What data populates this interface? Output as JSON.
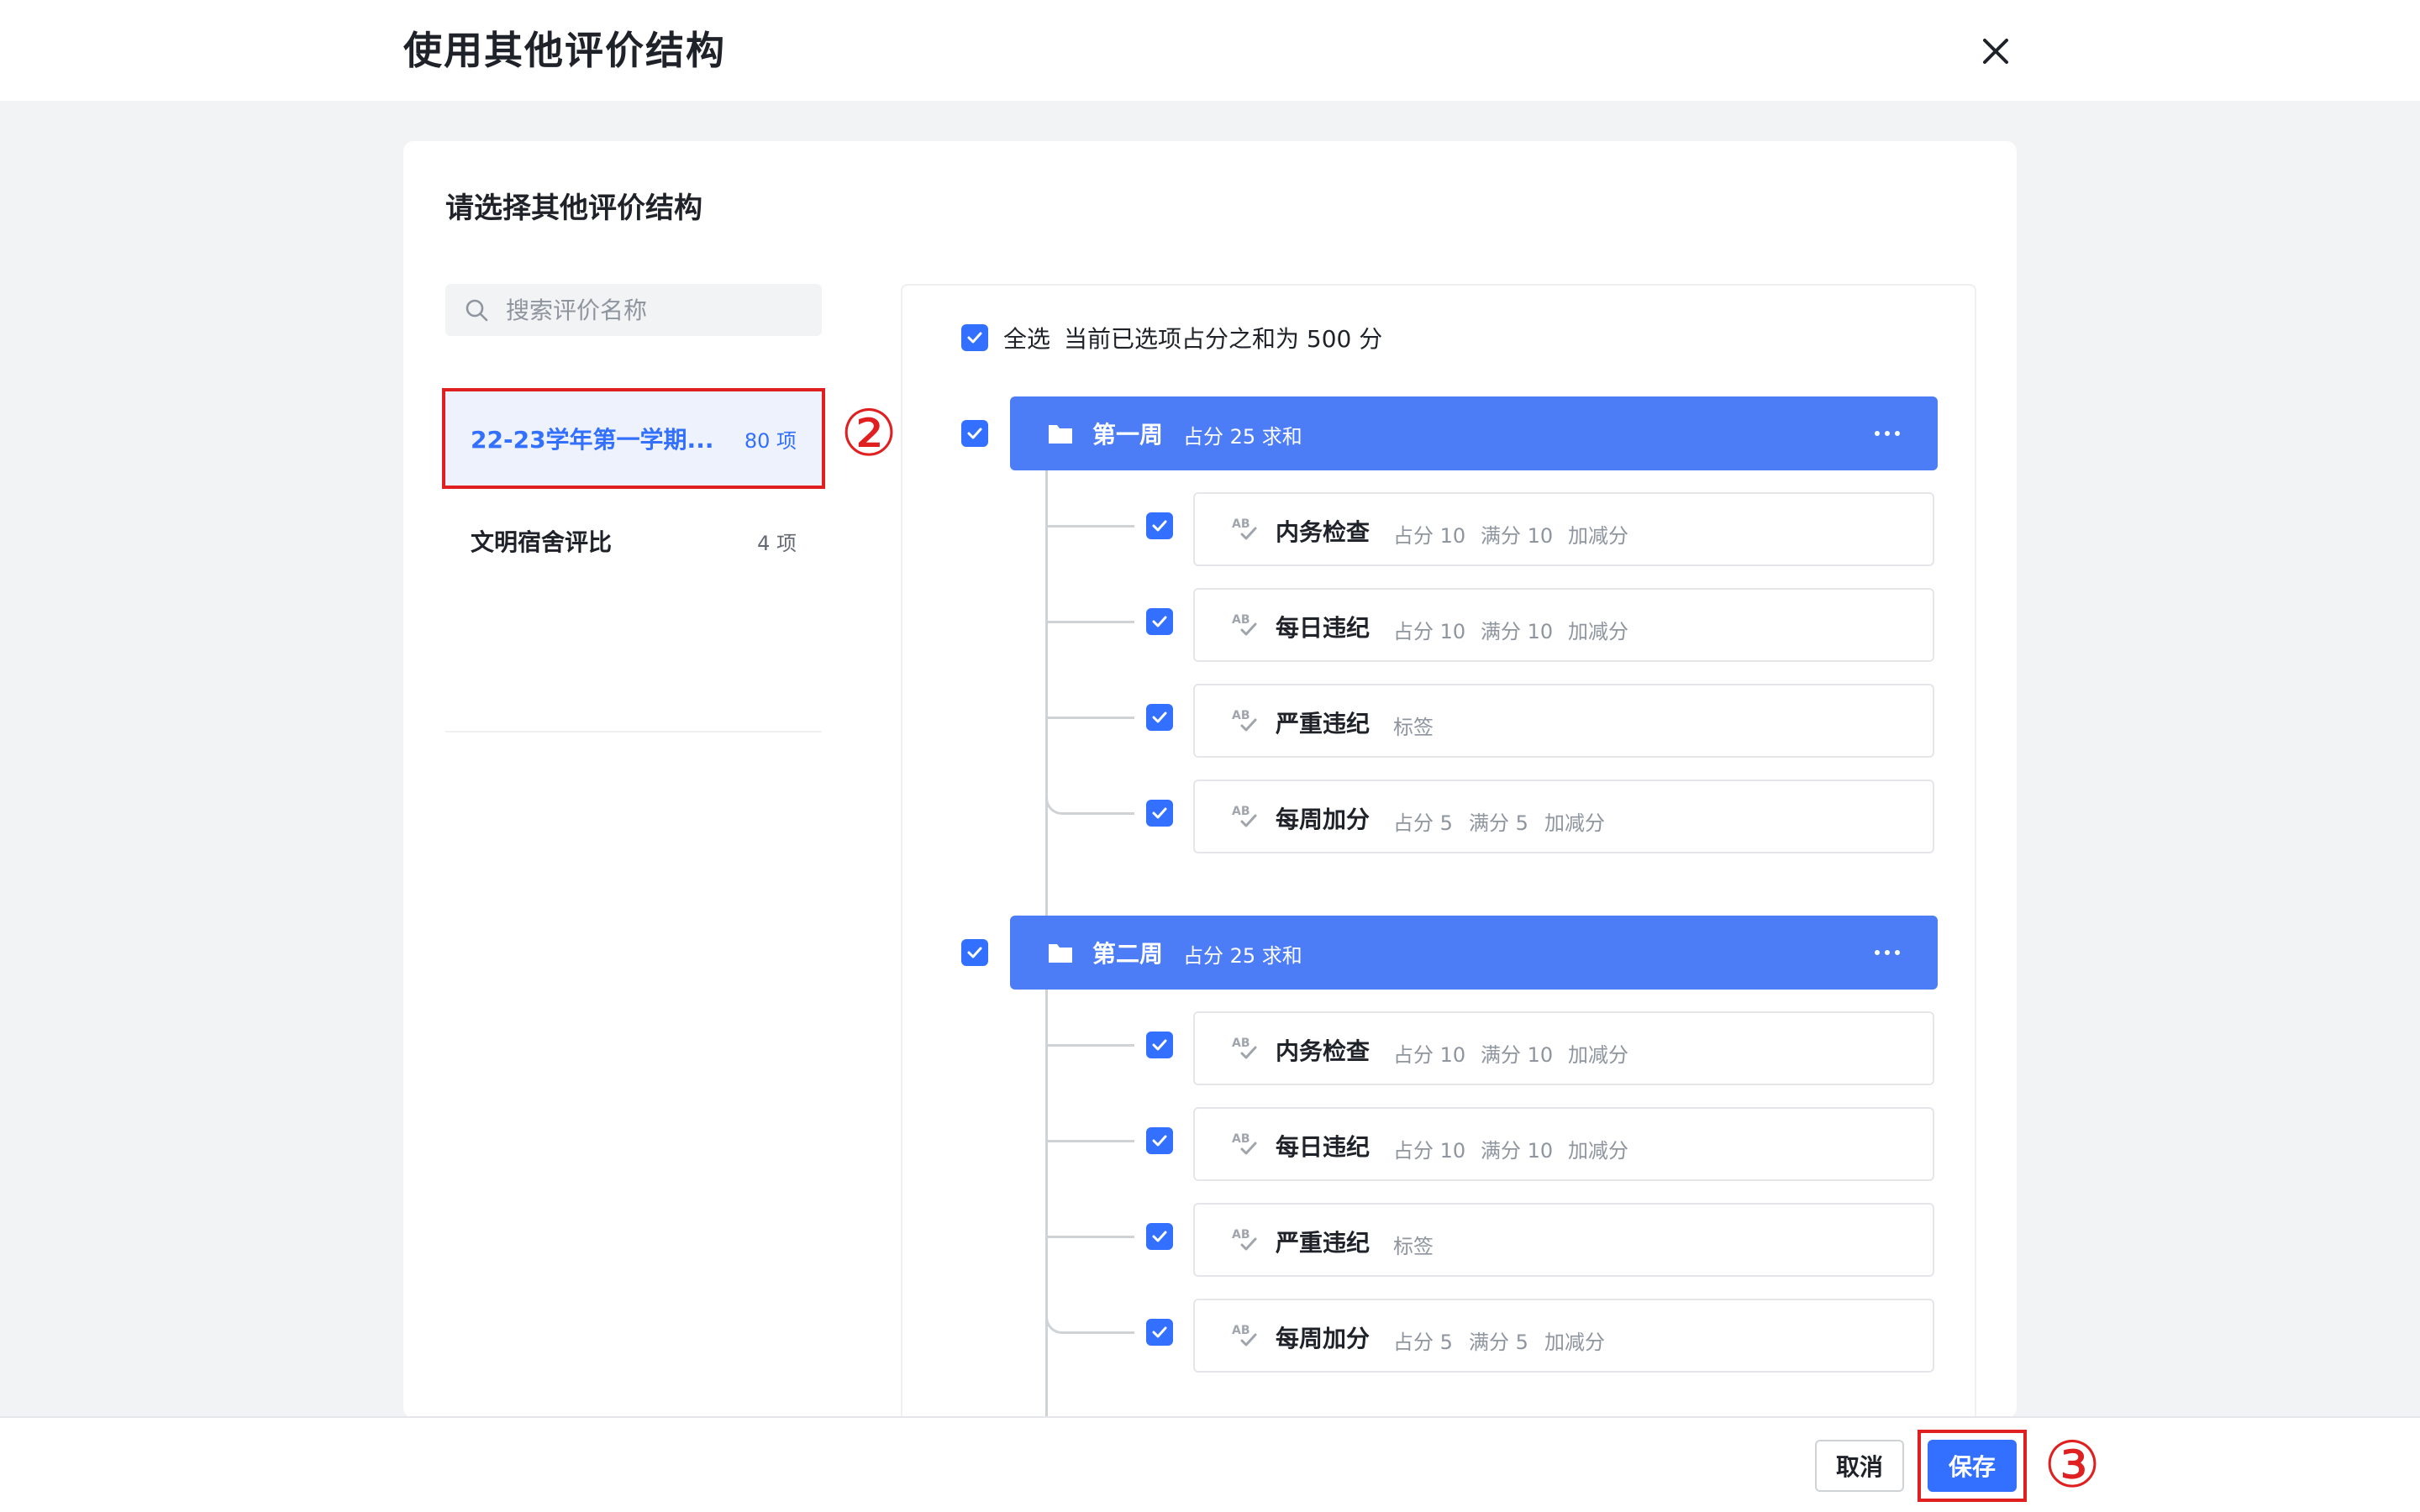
{
  "dialog": {
    "title": "使用其他评价结构",
    "card_title": "请选择其他评价结构"
  },
  "search": {
    "placeholder": "搜索评价名称"
  },
  "structures": [
    {
      "name": "22-23学年第一学期...",
      "count": "80 项",
      "selected": true
    },
    {
      "name": "文明宿舍评比",
      "count": "4 项",
      "selected": false
    }
  ],
  "markers": {
    "step2": "②",
    "step3": "③"
  },
  "selection": {
    "select_all_label": "全选",
    "summary": "当前已选项占分之和为 500 分"
  },
  "groups": [
    {
      "name": "第一周",
      "meta": "占分 25 求和",
      "items": [
        {
          "name": "内务检查",
          "meta": [
            "占分 10",
            "满分 10",
            "加减分"
          ]
        },
        {
          "name": "每日违纪",
          "meta": [
            "占分 10",
            "满分 10",
            "加减分"
          ]
        },
        {
          "name": "严重违纪",
          "meta": [
            "标签"
          ]
        },
        {
          "name": "每周加分",
          "meta": [
            "占分 5",
            "满分 5",
            "加减分"
          ]
        }
      ]
    },
    {
      "name": "第二周",
      "meta": "占分 25 求和",
      "items": [
        {
          "name": "内务检查",
          "meta": [
            "占分 10",
            "满分 10",
            "加减分"
          ]
        },
        {
          "name": "每日违纪",
          "meta": [
            "占分 10",
            "满分 10",
            "加减分"
          ]
        },
        {
          "name": "严重违纪",
          "meta": [
            "标签"
          ]
        },
        {
          "name": "每周加分",
          "meta": [
            "占分 5",
            "满分 5",
            "加减分"
          ]
        }
      ]
    }
  ],
  "footer": {
    "cancel_label": "取消",
    "save_label": "保存"
  },
  "colors": {
    "primary": "#3370ff",
    "group_header": "#4c7cf6",
    "highlight": "#e02020"
  }
}
